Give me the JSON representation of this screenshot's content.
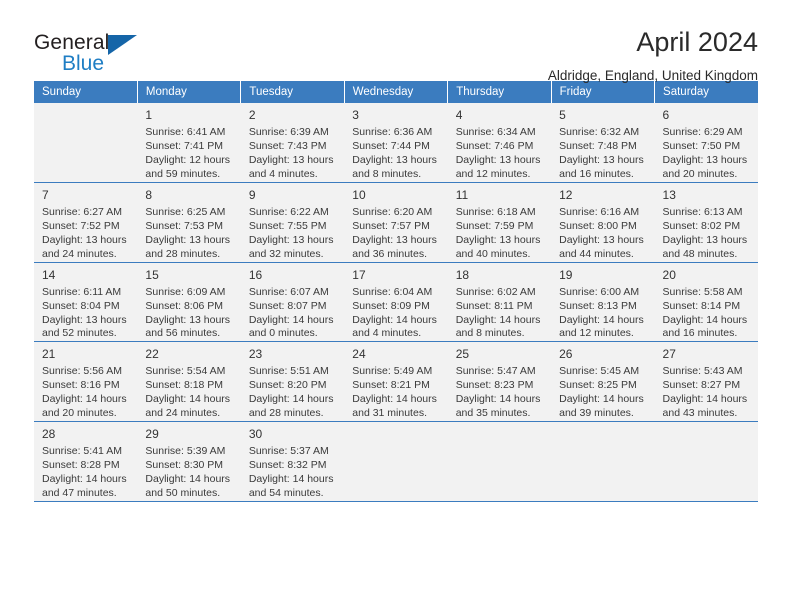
{
  "brand": {
    "name_top": "General",
    "name_bottom": "Blue",
    "accent_color": "#1f7ec4",
    "triangle_color": "#1565a8"
  },
  "header": {
    "title": "April 2024",
    "subtitle": "Aldridge, England, United Kingdom"
  },
  "calendar": {
    "header_bg": "#3b7cbf",
    "header_text_color": "#ffffff",
    "weekdays": [
      "Sunday",
      "Monday",
      "Tuesday",
      "Wednesday",
      "Thursday",
      "Friday",
      "Saturday"
    ],
    "labels": {
      "sunrise": "Sunrise:",
      "sunset": "Sunset:",
      "daylight": "Daylight:"
    },
    "weeks": [
      {
        "days": [
          {
            "num": "",
            "sunrise": "",
            "sunset": "",
            "daylight_line1": "",
            "daylight_line2": "",
            "empty": true
          },
          {
            "num": "1",
            "sunrise": "Sunrise: 6:41 AM",
            "sunset": "Sunset: 7:41 PM",
            "daylight_line1": "Daylight: 12 hours",
            "daylight_line2": "and 59 minutes.",
            "empty": false
          },
          {
            "num": "2",
            "sunrise": "Sunrise: 6:39 AM",
            "sunset": "Sunset: 7:43 PM",
            "daylight_line1": "Daylight: 13 hours",
            "daylight_line2": "and 4 minutes.",
            "empty": false
          },
          {
            "num": "3",
            "sunrise": "Sunrise: 6:36 AM",
            "sunset": "Sunset: 7:44 PM",
            "daylight_line1": "Daylight: 13 hours",
            "daylight_line2": "and 8 minutes.",
            "empty": false
          },
          {
            "num": "4",
            "sunrise": "Sunrise: 6:34 AM",
            "sunset": "Sunset: 7:46 PM",
            "daylight_line1": "Daylight: 13 hours",
            "daylight_line2": "and 12 minutes.",
            "empty": false
          },
          {
            "num": "5",
            "sunrise": "Sunrise: 6:32 AM",
            "sunset": "Sunset: 7:48 PM",
            "daylight_line1": "Daylight: 13 hours",
            "daylight_line2": "and 16 minutes.",
            "empty": false
          },
          {
            "num": "6",
            "sunrise": "Sunrise: 6:29 AM",
            "sunset": "Sunset: 7:50 PM",
            "daylight_line1": "Daylight: 13 hours",
            "daylight_line2": "and 20 minutes.",
            "empty": false
          }
        ]
      },
      {
        "days": [
          {
            "num": "7",
            "sunrise": "Sunrise: 6:27 AM",
            "sunset": "Sunset: 7:52 PM",
            "daylight_line1": "Daylight: 13 hours",
            "daylight_line2": "and 24 minutes.",
            "empty": false
          },
          {
            "num": "8",
            "sunrise": "Sunrise: 6:25 AM",
            "sunset": "Sunset: 7:53 PM",
            "daylight_line1": "Daylight: 13 hours",
            "daylight_line2": "and 28 minutes.",
            "empty": false
          },
          {
            "num": "9",
            "sunrise": "Sunrise: 6:22 AM",
            "sunset": "Sunset: 7:55 PM",
            "daylight_line1": "Daylight: 13 hours",
            "daylight_line2": "and 32 minutes.",
            "empty": false
          },
          {
            "num": "10",
            "sunrise": "Sunrise: 6:20 AM",
            "sunset": "Sunset: 7:57 PM",
            "daylight_line1": "Daylight: 13 hours",
            "daylight_line2": "and 36 minutes.",
            "empty": false
          },
          {
            "num": "11",
            "sunrise": "Sunrise: 6:18 AM",
            "sunset": "Sunset: 7:59 PM",
            "daylight_line1": "Daylight: 13 hours",
            "daylight_line2": "and 40 minutes.",
            "empty": false
          },
          {
            "num": "12",
            "sunrise": "Sunrise: 6:16 AM",
            "sunset": "Sunset: 8:00 PM",
            "daylight_line1": "Daylight: 13 hours",
            "daylight_line2": "and 44 minutes.",
            "empty": false
          },
          {
            "num": "13",
            "sunrise": "Sunrise: 6:13 AM",
            "sunset": "Sunset: 8:02 PM",
            "daylight_line1": "Daylight: 13 hours",
            "daylight_line2": "and 48 minutes.",
            "empty": false
          }
        ]
      },
      {
        "days": [
          {
            "num": "14",
            "sunrise": "Sunrise: 6:11 AM",
            "sunset": "Sunset: 8:04 PM",
            "daylight_line1": "Daylight: 13 hours",
            "daylight_line2": "and 52 minutes.",
            "empty": false
          },
          {
            "num": "15",
            "sunrise": "Sunrise: 6:09 AM",
            "sunset": "Sunset: 8:06 PM",
            "daylight_line1": "Daylight: 13 hours",
            "daylight_line2": "and 56 minutes.",
            "empty": false
          },
          {
            "num": "16",
            "sunrise": "Sunrise: 6:07 AM",
            "sunset": "Sunset: 8:07 PM",
            "daylight_line1": "Daylight: 14 hours",
            "daylight_line2": "and 0 minutes.",
            "empty": false
          },
          {
            "num": "17",
            "sunrise": "Sunrise: 6:04 AM",
            "sunset": "Sunset: 8:09 PM",
            "daylight_line1": "Daylight: 14 hours",
            "daylight_line2": "and 4 minutes.",
            "empty": false
          },
          {
            "num": "18",
            "sunrise": "Sunrise: 6:02 AM",
            "sunset": "Sunset: 8:11 PM",
            "daylight_line1": "Daylight: 14 hours",
            "daylight_line2": "and 8 minutes.",
            "empty": false
          },
          {
            "num": "19",
            "sunrise": "Sunrise: 6:00 AM",
            "sunset": "Sunset: 8:13 PM",
            "daylight_line1": "Daylight: 14 hours",
            "daylight_line2": "and 12 minutes.",
            "empty": false
          },
          {
            "num": "20",
            "sunrise": "Sunrise: 5:58 AM",
            "sunset": "Sunset: 8:14 PM",
            "daylight_line1": "Daylight: 14 hours",
            "daylight_line2": "and 16 minutes.",
            "empty": false
          }
        ]
      },
      {
        "days": [
          {
            "num": "21",
            "sunrise": "Sunrise: 5:56 AM",
            "sunset": "Sunset: 8:16 PM",
            "daylight_line1": "Daylight: 14 hours",
            "daylight_line2": "and 20 minutes.",
            "empty": false
          },
          {
            "num": "22",
            "sunrise": "Sunrise: 5:54 AM",
            "sunset": "Sunset: 8:18 PM",
            "daylight_line1": "Daylight: 14 hours",
            "daylight_line2": "and 24 minutes.",
            "empty": false
          },
          {
            "num": "23",
            "sunrise": "Sunrise: 5:51 AM",
            "sunset": "Sunset: 8:20 PM",
            "daylight_line1": "Daylight: 14 hours",
            "daylight_line2": "and 28 minutes.",
            "empty": false
          },
          {
            "num": "24",
            "sunrise": "Sunrise: 5:49 AM",
            "sunset": "Sunset: 8:21 PM",
            "daylight_line1": "Daylight: 14 hours",
            "daylight_line2": "and 31 minutes.",
            "empty": false
          },
          {
            "num": "25",
            "sunrise": "Sunrise: 5:47 AM",
            "sunset": "Sunset: 8:23 PM",
            "daylight_line1": "Daylight: 14 hours",
            "daylight_line2": "and 35 minutes.",
            "empty": false
          },
          {
            "num": "26",
            "sunrise": "Sunrise: 5:45 AM",
            "sunset": "Sunset: 8:25 PM",
            "daylight_line1": "Daylight: 14 hours",
            "daylight_line2": "and 39 minutes.",
            "empty": false
          },
          {
            "num": "27",
            "sunrise": "Sunrise: 5:43 AM",
            "sunset": "Sunset: 8:27 PM",
            "daylight_line1": "Daylight: 14 hours",
            "daylight_line2": "and 43 minutes.",
            "empty": false
          }
        ]
      },
      {
        "days": [
          {
            "num": "28",
            "sunrise": "Sunrise: 5:41 AM",
            "sunset": "Sunset: 8:28 PM",
            "daylight_line1": "Daylight: 14 hours",
            "daylight_line2": "and 47 minutes.",
            "empty": false
          },
          {
            "num": "29",
            "sunrise": "Sunrise: 5:39 AM",
            "sunset": "Sunset: 8:30 PM",
            "daylight_line1": "Daylight: 14 hours",
            "daylight_line2": "and 50 minutes.",
            "empty": false
          },
          {
            "num": "30",
            "sunrise": "Sunrise: 5:37 AM",
            "sunset": "Sunset: 8:32 PM",
            "daylight_line1": "Daylight: 14 hours",
            "daylight_line2": "and 54 minutes.",
            "empty": false
          },
          {
            "num": "",
            "sunrise": "",
            "sunset": "",
            "daylight_line1": "",
            "daylight_line2": "",
            "empty": true
          },
          {
            "num": "",
            "sunrise": "",
            "sunset": "",
            "daylight_line1": "",
            "daylight_line2": "",
            "empty": true
          },
          {
            "num": "",
            "sunrise": "",
            "sunset": "",
            "daylight_line1": "",
            "daylight_line2": "",
            "empty": true
          },
          {
            "num": "",
            "sunrise": "",
            "sunset": "",
            "daylight_line1": "",
            "daylight_line2": "",
            "empty": true
          }
        ]
      }
    ]
  }
}
